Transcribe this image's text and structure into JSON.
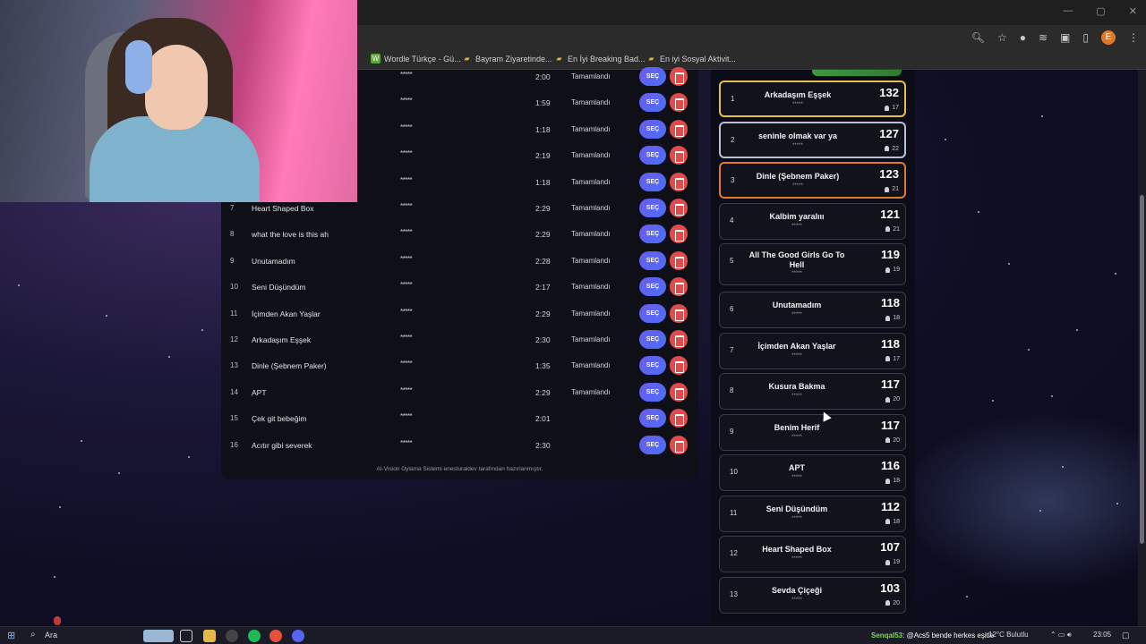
{
  "browser": {
    "bookmarks": [
      {
        "label": "Wordle Türkçe - Gü...",
        "icon": "w-icon"
      },
      {
        "label": "Bayram Ziyaretinde...",
        "icon": "folder-icon"
      },
      {
        "label": "En İyi Breaking Bad...",
        "icon": "folder-icon"
      },
      {
        "label": "En iyi Sosyal Aktivit...",
        "icon": "folder-icon"
      }
    ],
    "profile_initial": "E"
  },
  "song_table": {
    "rows": [
      {
        "num": "",
        "title": "",
        "stars": "*****",
        "duration": "2:00",
        "status": "Tamamlandı"
      },
      {
        "num": "",
        "title": "",
        "stars": "*****",
        "duration": "1:59",
        "status": "Tamamlandı"
      },
      {
        "num": "",
        "title": "",
        "stars": "*****",
        "duration": "1:18",
        "status": "Tamamlandı"
      },
      {
        "num": "",
        "title": "",
        "stars": "*****",
        "duration": "2:19",
        "status": "Tamamlandı"
      },
      {
        "num": "",
        "title": "",
        "stars": "*****",
        "duration": "1:18",
        "status": "Tamamlandı"
      },
      {
        "num": "7",
        "title": "Heart Shaped Box",
        "stars": "*****",
        "duration": "2:29",
        "status": "Tamamlandı"
      },
      {
        "num": "8",
        "title": "what the love is this ah",
        "stars": "*****",
        "duration": "2:29",
        "status": "Tamamlandı"
      },
      {
        "num": "9",
        "title": "Unutamadım",
        "stars": "*****",
        "duration": "2:28",
        "status": "Tamamlandı"
      },
      {
        "num": "10",
        "title": "Seni Düşündüm",
        "stars": "*****",
        "duration": "2:17",
        "status": "Tamamlandı"
      },
      {
        "num": "11",
        "title": "İçimden Akan Yaşlar",
        "stars": "*****",
        "duration": "2:29",
        "status": "Tamamlandı"
      },
      {
        "num": "12",
        "title": "Arkadaşım Eşşek",
        "stars": "*****",
        "duration": "2:30",
        "status": "Tamamlandı"
      },
      {
        "num": "13",
        "title": "Dinle (Şebnem Paker)",
        "stars": "*****",
        "duration": "1:35",
        "status": "Tamamlandı"
      },
      {
        "num": "14",
        "title": "APT",
        "stars": "*****",
        "duration": "2:29",
        "status": "Tamamlandı"
      },
      {
        "num": "15",
        "title": "Çek git bebeğim",
        "stars": "*****",
        "duration": "2:01",
        "status": ""
      },
      {
        "num": "16",
        "title": "Acıtır gibi severek",
        "stars": "*****",
        "duration": "2:30",
        "status": ""
      }
    ],
    "select_label": "SEÇ",
    "footer": "AI-Vision Oylama Sistemi enesturaldev tarafından hazırlanmıştır."
  },
  "ranking": {
    "cards": [
      {
        "pos": "1",
        "title": "Arkadaşım Eşşek",
        "stars": "*****",
        "score": "132",
        "voters": "17",
        "tier": "gold"
      },
      {
        "pos": "2",
        "title": "seninle olmak var ya",
        "stars": "*****",
        "score": "127",
        "voters": "22",
        "tier": "silver"
      },
      {
        "pos": "3",
        "title": "Dinle (Şebnem Paker)",
        "stars": "*****",
        "score": "123",
        "voters": "21",
        "tier": "bronze"
      },
      {
        "pos": "4",
        "title": "Kalbim yaralııı",
        "stars": "*****",
        "score": "121",
        "voters": "21",
        "tier": ""
      },
      {
        "pos": "5",
        "title": "All The Good Girls Go To Hell",
        "stars": "*****",
        "score": "119",
        "voters": "19",
        "tier": "tall"
      },
      {
        "pos": "6",
        "title": "Unutamadım",
        "stars": "*****",
        "score": "118",
        "voters": "18",
        "tier": ""
      },
      {
        "pos": "7",
        "title": "İçimden Akan Yaşlar",
        "stars": "*****",
        "score": "118",
        "voters": "17",
        "tier": ""
      },
      {
        "pos": "8",
        "title": "Kusura Bakma",
        "stars": "*****",
        "score": "117",
        "voters": "20",
        "tier": ""
      },
      {
        "pos": "9",
        "title": "Benim Herif",
        "stars": "*****",
        "score": "117",
        "voters": "20",
        "tier": ""
      },
      {
        "pos": "10",
        "title": "APT",
        "stars": "*****",
        "score": "116",
        "voters": "18",
        "tier": ""
      },
      {
        "pos": "11",
        "title": "Seni Düşündüm",
        "stars": "*****",
        "score": "112",
        "voters": "18",
        "tier": ""
      },
      {
        "pos": "12",
        "title": "Heart Shaped Box",
        "stars": "*****",
        "score": "107",
        "voters": "19",
        "tier": ""
      },
      {
        "pos": "13",
        "title": "Sevda Çiçeği",
        "stars": "*****",
        "score": "103",
        "voters": "20",
        "tier": ""
      }
    ]
  },
  "taskbar": {
    "search_label": "Ara",
    "ticker_user": "Senqal53",
    "ticker_msg": ": @Acs5 bende herkes eşitle",
    "weather": "12°C Bulutlu",
    "time": "23:05"
  },
  "colors": {
    "select_button": "#5b66f2",
    "delete_button": "#e24b4b",
    "rank_gold": "#e5c04a",
    "rank_silver": "#b8c0d4",
    "rank_bronze": "#e07a2c"
  }
}
